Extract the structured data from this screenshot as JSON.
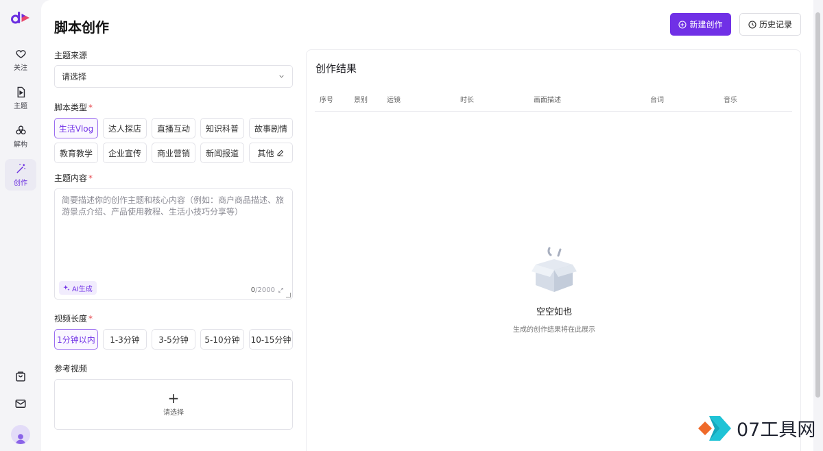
{
  "sidebar": {
    "items": [
      {
        "label": "关注",
        "icon": "heart-icon"
      },
      {
        "label": "主题",
        "icon": "doc-play-icon"
      },
      {
        "label": "解构",
        "icon": "deconstruct-icon"
      },
      {
        "label": "创作",
        "icon": "magic-wand-icon"
      }
    ],
    "active": "创作"
  },
  "header": {
    "title": "脚本创作",
    "new_label": "新建创作",
    "history_label": "历史记录"
  },
  "form": {
    "source": {
      "label": "主题来源",
      "value": "请选择"
    },
    "script_type": {
      "label": "脚本类型",
      "required": "*",
      "options": [
        "生活Vlog",
        "达人探店",
        "直播互动",
        "知识科普",
        "故事剧情",
        "教育教学",
        "企业宣传",
        "商业营销",
        "新闻报道",
        "其他"
      ],
      "selected": "生活Vlog"
    },
    "content": {
      "label": "主题内容",
      "required": "*",
      "placeholder": "简要描述你的创作主题和核心内容（例如：商户商品描述、旅游景点介绍、产品使用教程、生活小技巧分享等）",
      "ai_label": "AI生成",
      "count": "0",
      "max": "/2000"
    },
    "duration": {
      "label": "视频长度",
      "required": "*",
      "options": [
        "1分钟以内",
        "1-3分钟",
        "3-5分钟",
        "5-10分钟",
        "10-15分钟"
      ],
      "selected": "1分钟以内"
    },
    "reference": {
      "label": "参考视频",
      "plus": "+",
      "placeholder": "请选择"
    }
  },
  "result": {
    "title": "创作结果",
    "columns": [
      "序号",
      "景别",
      "运镜",
      "时长",
      "画面描述",
      "台词",
      "音乐"
    ],
    "empty_title": "空空如也",
    "empty_sub": "生成的创作结果将在此展示"
  },
  "watermark": {
    "text": "07工具网"
  },
  "colors": {
    "accent": "#7030e6",
    "required": "#e5484d",
    "border": "#e2e2e8"
  }
}
